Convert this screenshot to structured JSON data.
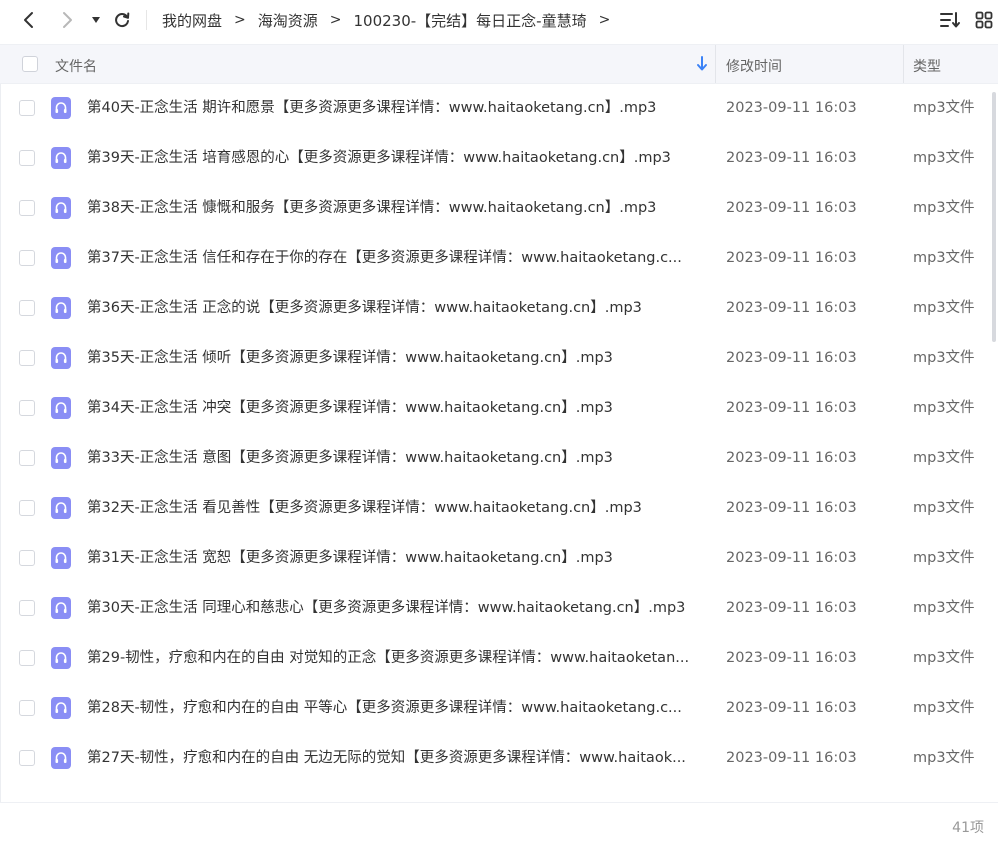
{
  "nav": {
    "back_icon": "chevron-left-icon",
    "forward_icon": "chevron-right-icon",
    "history_icon": "caret-down-icon",
    "refresh_icon": "refresh-icon"
  },
  "breadcrumb": [
    {
      "label": "我的网盘"
    },
    {
      "label": "海淘资源"
    },
    {
      "label": "100230-【完结】每日正念-童慧琦"
    }
  ],
  "breadcrumb_sep": ">",
  "toolbar": {
    "sort_icon": "sort-list-icon",
    "view_icon": "grid-view-icon"
  },
  "header": {
    "name_label": "文件名",
    "time_label": "修改时间",
    "type_label": "类型",
    "sort_icon": "arrow-down-icon"
  },
  "files": [
    {
      "name": "第40天-正念生活 期许和愿景【更多资源更多课程详情：www.haitaoketang.cn】.mp3",
      "time": "2023-09-11 16:03",
      "type": "mp3文件"
    },
    {
      "name": "第39天-正念生活 培育感恩的心【更多资源更多课程详情：www.haitaoketang.cn】.mp3",
      "time": "2023-09-11 16:03",
      "type": "mp3文件"
    },
    {
      "name": "第38天-正念生活 慷慨和服务【更多资源更多课程详情：www.haitaoketang.cn】.mp3",
      "time": "2023-09-11 16:03",
      "type": "mp3文件"
    },
    {
      "name": "第37天-正念生活 信任和存在于你的存在【更多资源更多课程详情：www.haitaoketang.c...",
      "time": "2023-09-11 16:03",
      "type": "mp3文件"
    },
    {
      "name": "第36天-正念生活 正念的说【更多资源更多课程详情：www.haitaoketang.cn】.mp3",
      "time": "2023-09-11 16:03",
      "type": "mp3文件"
    },
    {
      "name": "第35天-正念生活 倾听【更多资源更多课程详情：www.haitaoketang.cn】.mp3",
      "time": "2023-09-11 16:03",
      "type": "mp3文件"
    },
    {
      "name": "第34天-正念生活 冲突【更多资源更多课程详情：www.haitaoketang.cn】.mp3",
      "time": "2023-09-11 16:03",
      "type": "mp3文件"
    },
    {
      "name": "第33天-正念生活 意图【更多资源更多课程详情：www.haitaoketang.cn】.mp3",
      "time": "2023-09-11 16:03",
      "type": "mp3文件"
    },
    {
      "name": "第32天-正念生活 看见善性【更多资源更多课程详情：www.haitaoketang.cn】.mp3",
      "time": "2023-09-11 16:03",
      "type": "mp3文件"
    },
    {
      "name": "第31天-正念生活 宽恕【更多资源更多课程详情：www.haitaoketang.cn】.mp3",
      "time": "2023-09-11 16:03",
      "type": "mp3文件"
    },
    {
      "name": "第30天-正念生活 同理心和慈悲心【更多资源更多课程详情：www.haitaoketang.cn】.mp3",
      "time": "2023-09-11 16:03",
      "type": "mp3文件"
    },
    {
      "name": "第29-韧性，疗愈和内在的自由 对觉知的正念【更多资源更多课程详情：www.haitaoketan...",
      "time": "2023-09-11 16:03",
      "type": "mp3文件"
    },
    {
      "name": "第28天-韧性，疗愈和内在的自由 平等心【更多资源更多课程详情：www.haitaoketang.c...",
      "time": "2023-09-11 16:03",
      "type": "mp3文件"
    },
    {
      "name": "第27天-韧性，疗愈和内在的自由 无边无际的觉知【更多资源更多课程详情：www.haitaok...",
      "time": "2023-09-11 16:03",
      "type": "mp3文件"
    }
  ],
  "file_icon": "audio-file-icon",
  "colors": {
    "file_icon_bg": "#8a8ef5",
    "header_bg": "#f5f6fa",
    "sort_arrow": "#3b82f6"
  },
  "footer": {
    "count": "41项"
  }
}
